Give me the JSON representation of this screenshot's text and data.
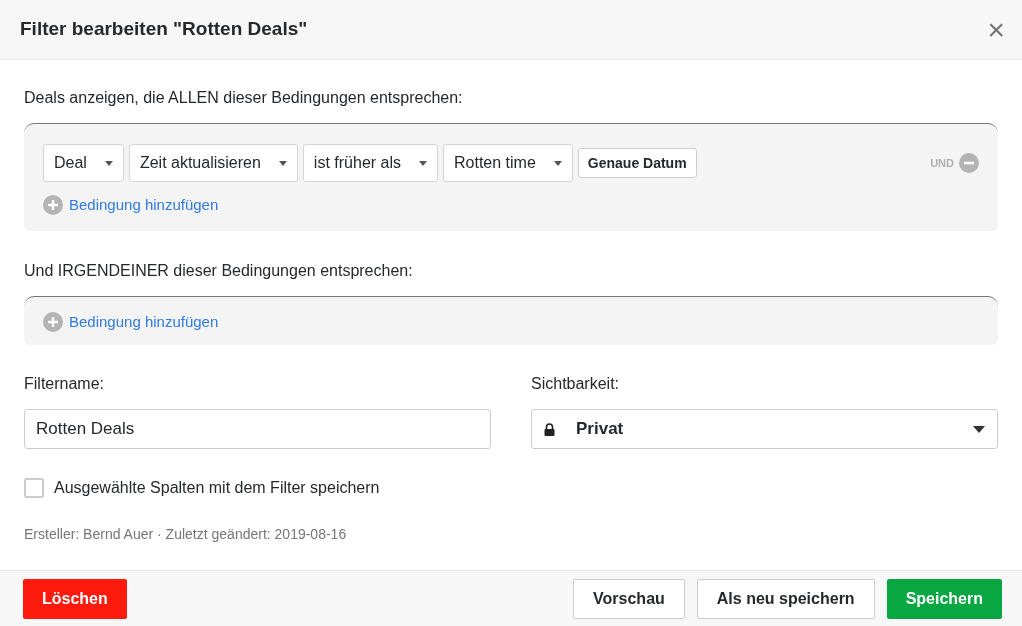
{
  "dialog": {
    "title": "Filter bearbeiten \"Rotten Deals\"",
    "close_icon": "×"
  },
  "all_section": {
    "heading": "Deals anzeigen, die ALLEN dieser Bedingungen entsprechen:",
    "conditions": [
      {
        "fields": [
          {
            "kind": "select",
            "value": "Deal"
          },
          {
            "kind": "select",
            "value": "Zeit aktualisieren"
          },
          {
            "kind": "select",
            "value": "ist früher als"
          },
          {
            "kind": "select",
            "value": "Rotten time"
          },
          {
            "kind": "button",
            "value": "Genaue Datum"
          }
        ],
        "connector": "UND"
      }
    ],
    "add_link": "Bedingung hinzufügen"
  },
  "any_section": {
    "heading": "Und IRGENDEINER dieser Bedingungen entsprechen:",
    "add_link": "Bedingung hinzufügen"
  },
  "filter_name": {
    "label": "Filtername:",
    "value": "Rotten Deals"
  },
  "visibility": {
    "label": "Sichtbarkeit:",
    "value": "Privat"
  },
  "save_columns": {
    "label": "Ausgewählte Spalten mit dem Filter speichern",
    "checked": false
  },
  "meta": "Ersteller: Bernd Auer · Zuletzt geändert: 2019-08-16",
  "footer": {
    "delete": "Löschen",
    "buttons": [
      {
        "label": "Vorschau",
        "kind": "secondary"
      },
      {
        "label": "Als neu speichern",
        "kind": "secondary"
      },
      {
        "label": "Speichern",
        "kind": "primary"
      }
    ]
  }
}
